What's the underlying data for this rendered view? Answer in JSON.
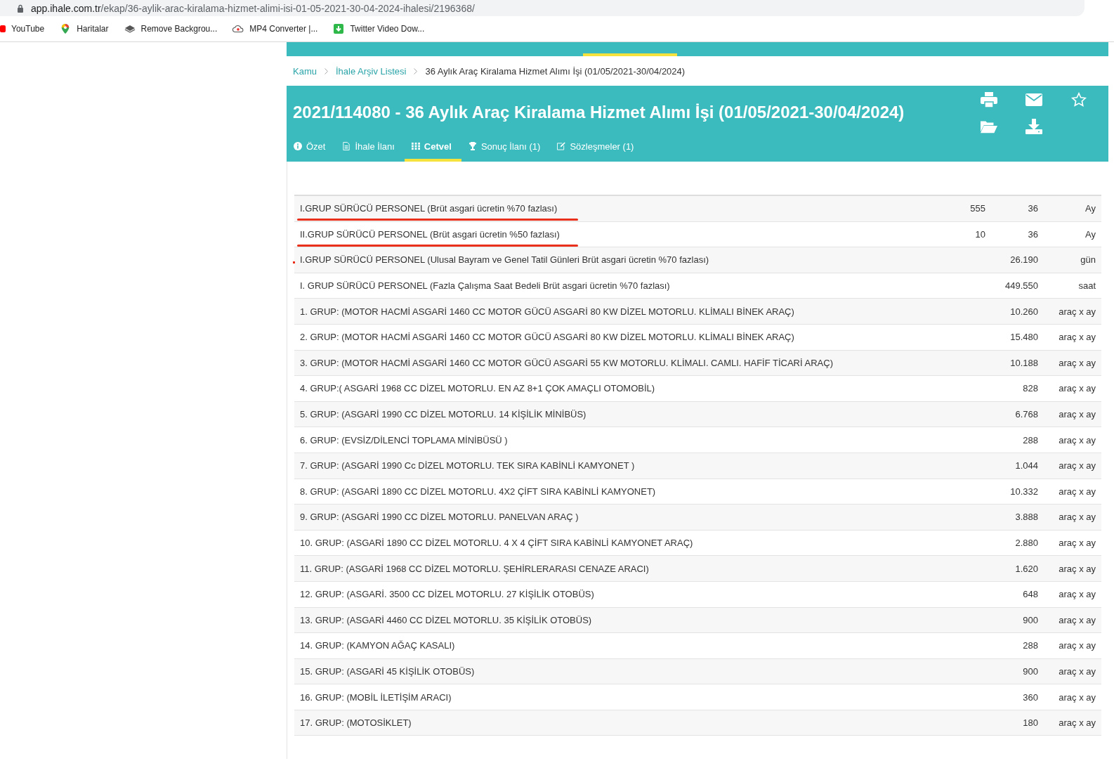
{
  "browser": {
    "url_host": "app.ihale.com.tr",
    "url_path": "/ekap/36-aylik-arac-kiralama-hizmet-alimi-isi-01-05-2021-30-04-2024-ihalesi/2196368/",
    "bookmarks": [
      {
        "label": "YouTube"
      },
      {
        "label": "Haritalar"
      },
      {
        "label": "Remove Backgrou..."
      },
      {
        "label": "MP4 Converter |..."
      },
      {
        "label": "Twitter Video Dow..."
      }
    ]
  },
  "breadcrumb": [
    {
      "label": "Kamu",
      "link": true
    },
    {
      "label": "İhale Arşiv Listesi",
      "link": true
    },
    {
      "label": "36 Aylık Araç Kiralama Hizmet Alımı İşi (01/05/2021-30/04/2024)",
      "link": false
    }
  ],
  "header": {
    "title": "2021/114080 - 36 Aylık Araç Kiralama Hizmet Alımı İşi (01/05/2021-30/04/2024)",
    "tabs": [
      {
        "label": "Özet",
        "selected": false
      },
      {
        "label": "İhale İlanı",
        "selected": false
      },
      {
        "label": "Cetvel",
        "selected": true
      },
      {
        "label": "Sonuç İlanı (1)",
        "selected": false
      },
      {
        "label": "Sözleşmeler (1)",
        "selected": false
      }
    ]
  },
  "table": {
    "rows": [
      {
        "item": "I.GRUP SÜRÜCÜ PERSONEL (Brüt asgari ücretin %70 fazlası)",
        "column_2": "555",
        "quantity": "36",
        "unit": "Ay",
        "underlined": true,
        "flagged": false
      },
      {
        "item": "II.GRUP SÜRÜCÜ PERSONEL (Brüt asgari ücretin %50 fazlası)",
        "column_2": "10",
        "quantity": "36",
        "unit": "Ay",
        "underlined": true,
        "flagged": false
      },
      {
        "item": "I.GRUP SÜRÜCÜ PERSONEL (Ulusal Bayram ve Genel Tatil Günleri Brüt asgari ücretin %70 fazlası)",
        "quantity": "26.190",
        "unit": "gün",
        "underlined": false,
        "flagged": true
      },
      {
        "item": "I. GRUP SÜRÜCÜ PERSONEL (Fazla Çalışma Saat Bedeli Brüt asgari ücretin %70 fazlası)",
        "quantity": "449.550",
        "unit": "saat",
        "underlined": false,
        "flagged": false
      },
      {
        "item": "1. GRUP: (MOTOR HACMİ ASGARİ 1460 CC MOTOR GÜCÜ ASGARİ 80 KW DİZEL MOTORLU. KLİMALI BİNEK ARAÇ)",
        "quantity": "10.260",
        "unit": "araç x ay",
        "underlined": false,
        "flagged": false
      },
      {
        "item": "2. GRUP: (MOTOR HACMİ ASGARİ 1460 CC MOTOR GÜCÜ ASGARİ 80 KW DİZEL MOTORLU. KLİMALI BİNEK ARAÇ)",
        "quantity": "15.480",
        "unit": "araç x ay",
        "underlined": false,
        "flagged": false
      },
      {
        "item": "3. GRUP: (MOTOR HACMİ ASGARİ 1460 CC MOTOR GÜCÜ ASGARİ 55 KW MOTORLU. KLİMALI. CAMLI. HAFİF TİCARİ ARAÇ)",
        "quantity": "10.188",
        "unit": "araç x ay",
        "underlined": false,
        "flagged": false
      },
      {
        "item": "4. GRUP:( ASGARİ 1968 CC DİZEL MOTORLU. EN AZ 8+1 ÇOK AMAÇLI OTOMOBİL)",
        "quantity": "828",
        "unit": "araç x ay",
        "underlined": false,
        "flagged": false
      },
      {
        "item": "5. GRUP: (ASGARİ 1990 CC DİZEL MOTORLU. 14 KİŞİLİK MİNİBÜS)",
        "quantity": "6.768",
        "unit": "araç x ay",
        "underlined": false,
        "flagged": false
      },
      {
        "item": "6. GRUP: (EVSİZ/DİLENCİ TOPLAMA MİNİBÜSÜ )",
        "quantity": "288",
        "unit": "araç x ay",
        "underlined": false,
        "flagged": false
      },
      {
        "item": "7. GRUP: (ASGARİ 1990 Cc DİZEL MOTORLU. TEK SIRA KABİNLİ KAMYONET )",
        "quantity": "1.044",
        "unit": "araç x ay",
        "underlined": false,
        "flagged": false
      },
      {
        "item": "8. GRUP: (ASGARİ 1890 CC DİZEL MOTORLU. 4X2 ÇİFT SIRA KABİNLİ KAMYONET)",
        "quantity": "10.332",
        "unit": "araç x ay",
        "underlined": false,
        "flagged": false
      },
      {
        "item": "9. GRUP: (ASGARİ 1990 CC DİZEL MOTORLU. PANELVAN ARAÇ )",
        "quantity": "3.888",
        "unit": "araç x ay",
        "underlined": false,
        "flagged": false
      },
      {
        "item": "10. GRUP: (ASGARİ 1890 CC DİZEL MOTORLU. 4 X 4 ÇİFT SIRA KABİNLİ KAMYONET ARAÇ)",
        "quantity": "2.880",
        "unit": "araç x ay",
        "underlined": false,
        "flagged": false
      },
      {
        "item": "11. GRUP: (ASGARİ 1968 CC DİZEL MOTORLU. ŞEHİRLERARASI CENAZE ARACI)",
        "quantity": "1.620",
        "unit": "araç x ay",
        "underlined": false,
        "flagged": false
      },
      {
        "item": "12. GRUP: (ASGARİ. 3500 CC DİZEL MOTORLU. 27 KİŞİLİK OTOBÜS)",
        "quantity": "648",
        "unit": "araç x ay",
        "underlined": false,
        "flagged": false
      },
      {
        "item": "13. GRUP: (ASGARİ 4460 CC DİZEL MOTORLU. 35 KİŞİLİK OTOBÜS)",
        "quantity": "900",
        "unit": "araç x ay",
        "underlined": false,
        "flagged": false
      },
      {
        "item": "14. GRUP: (KAMYON AĞAÇ KASALI)",
        "quantity": "288",
        "unit": "araç x ay",
        "underlined": false,
        "flagged": false
      },
      {
        "item": "15. GRUP: (ASGARİ 45 KİŞİLİK OTOBÜS)",
        "quantity": "900",
        "unit": "araç x ay",
        "underlined": false,
        "flagged": false
      },
      {
        "item": "16. GRUP: (MOBİL İLETİŞİM ARACI)",
        "quantity": "360",
        "unit": "araç x ay",
        "underlined": false,
        "flagged": false
      },
      {
        "item": "17. GRUP: (MOTOSİKLET)",
        "quantity": "180",
        "unit": "araç x ay",
        "underlined": false,
        "flagged": false
      }
    ]
  }
}
